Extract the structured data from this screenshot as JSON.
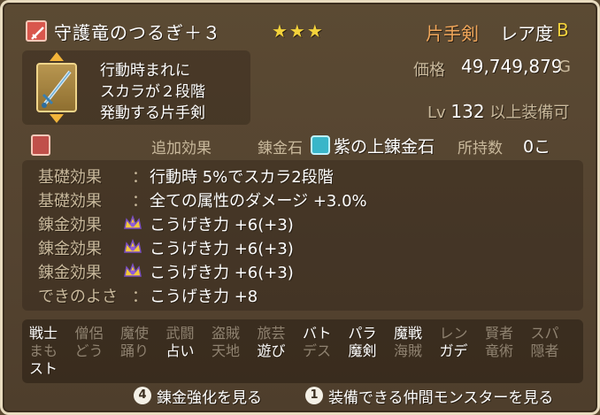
{
  "header": {
    "item_name": "守護竜のつるぎ＋３",
    "stars": "★★★",
    "weapon_type": "片手剣",
    "rarity_label": "レア度",
    "rarity_value": "B"
  },
  "description": {
    "lines": [
      "行動時まれに",
      "スカラが２段階",
      "発動する片手剣"
    ]
  },
  "price": {
    "label": "価格",
    "value": "49,749,879",
    "unit": "G"
  },
  "level": {
    "prefix": "Lv",
    "value": "132",
    "suffix": "以上装備可"
  },
  "alchemy": {
    "extra_effect_label": "追加効果",
    "stone_label": "錬金石",
    "stone_name": "紫の上錬金石",
    "owned_label": "所持数",
    "owned_value": "0こ"
  },
  "effects": [
    {
      "category": "基礎効果",
      "colon": "：",
      "text": "行動時 5%でスカラ2段階",
      "icon": null
    },
    {
      "category": "基礎効果",
      "colon": "：",
      "text": "全ての属性のダメージ +3.0%",
      "icon": null
    },
    {
      "category": "錬金効果",
      "colon": "",
      "text": "こうげき力 +6(+3)",
      "icon": "crown-icon"
    },
    {
      "category": "錬金効果",
      "colon": "",
      "text": "こうげき力 +6(+3)",
      "icon": "crown-icon"
    },
    {
      "category": "錬金効果",
      "colon": "",
      "text": "こうげき力 +6(+3)",
      "icon": "crown-icon"
    },
    {
      "category": "できのよさ",
      "colon": "：",
      "text": "こうげき力 +8",
      "icon": null
    }
  ],
  "jobs": [
    {
      "label": "戦士",
      "enabled": true
    },
    {
      "label": "僧侶",
      "enabled": false
    },
    {
      "label": "魔使",
      "enabled": false
    },
    {
      "label": "武闘",
      "enabled": false
    },
    {
      "label": "盗賊",
      "enabled": false
    },
    {
      "label": "旅芸",
      "enabled": false
    },
    {
      "label": "バト",
      "enabled": true
    },
    {
      "label": "パラ",
      "enabled": true
    },
    {
      "label": "魔戦",
      "enabled": true
    },
    {
      "label": "レン",
      "enabled": false
    },
    {
      "label": "賢者",
      "enabled": false
    },
    {
      "label": "スパ",
      "enabled": false
    },
    {
      "label": "まも",
      "enabled": false
    },
    {
      "label": "どう",
      "enabled": false
    },
    {
      "label": "踊り",
      "enabled": false
    },
    {
      "label": "占い",
      "enabled": true
    },
    {
      "label": "天地",
      "enabled": false
    },
    {
      "label": "遊び",
      "enabled": true
    },
    {
      "label": "デス",
      "enabled": false
    },
    {
      "label": "魔剣",
      "enabled": true
    },
    {
      "label": "海賊",
      "enabled": false
    },
    {
      "label": "ガデ",
      "enabled": true
    },
    {
      "label": "竜術",
      "enabled": false
    },
    {
      "label": "隠者",
      "enabled": false
    },
    {
      "label": "スト",
      "enabled": true
    }
  ],
  "footer": {
    "left_button_key": "4",
    "left_button_label": "錬金強化を見る",
    "right_button_key": "1",
    "right_button_label": "装備できる仲間モンスターを見る"
  },
  "colors": {
    "accent_yellow": "#f3d23b",
    "weapon_orange": "#f0a65a",
    "label_tan": "#c9b99c",
    "disabled_job": "#8f8270"
  }
}
